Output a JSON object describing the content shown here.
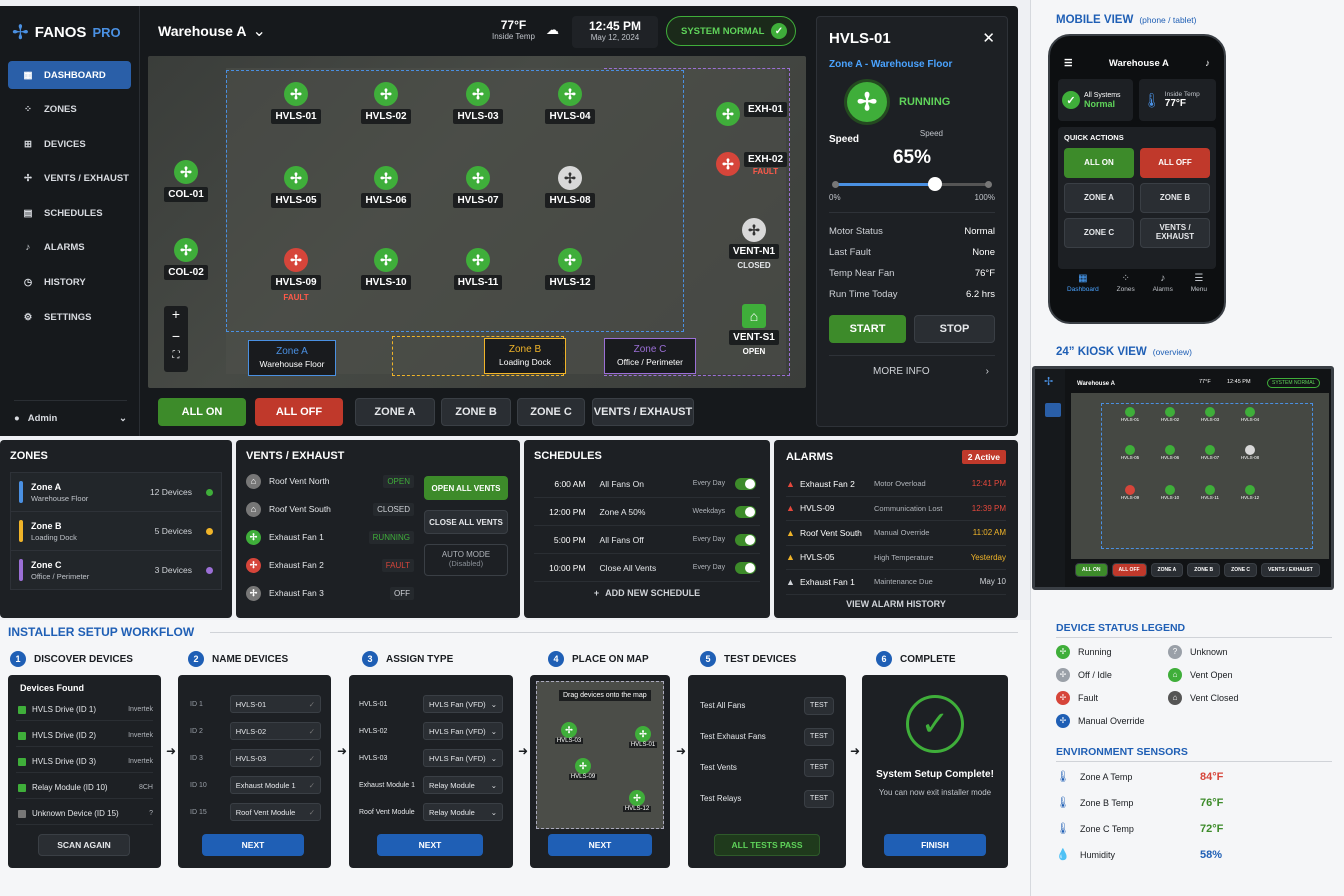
{
  "brand": {
    "name": "FANOS",
    "suffix": "PRO"
  },
  "sidebar": {
    "items": [
      {
        "label": "DASHBOARD",
        "icon": "dashboard-icon",
        "glyph": "▦"
      },
      {
        "label": "ZONES",
        "icon": "zones-icon",
        "glyph": "⁘"
      },
      {
        "label": "DEVICES",
        "icon": "devices-icon",
        "glyph": "⊞"
      },
      {
        "label": "VENTS / EXHAUST",
        "icon": "fan-icon",
        "glyph": "✢"
      },
      {
        "label": "SCHEDULES",
        "icon": "calendar-icon",
        "glyph": "▤"
      },
      {
        "label": "ALARMS",
        "icon": "bell-icon",
        "glyph": "♪"
      },
      {
        "label": "HISTORY",
        "icon": "clock-icon",
        "glyph": "◷"
      },
      {
        "label": "SETTINGS",
        "icon": "gear-icon",
        "glyph": "⚙"
      }
    ],
    "user": "Admin"
  },
  "header": {
    "location": "Warehouse A",
    "temp": "77°F",
    "temp_label": "Inside Temp",
    "time": "12:45 PM",
    "date": "May 12, 2024",
    "system_status": "SYSTEM NORMAL"
  },
  "map": {
    "fans": [
      {
        "id": "HVLS-01",
        "s": "g"
      },
      {
        "id": "HVLS-02",
        "s": "g"
      },
      {
        "id": "HVLS-03",
        "s": "g"
      },
      {
        "id": "HVLS-04",
        "s": "g"
      },
      {
        "id": "HVLS-05",
        "s": "g"
      },
      {
        "id": "HVLS-06",
        "s": "g"
      },
      {
        "id": "HVLS-07",
        "s": "g"
      },
      {
        "id": "HVLS-08",
        "s": "w"
      },
      {
        "id": "HVLS-09",
        "s": "r",
        "status": "FAULT"
      },
      {
        "id": "HVLS-10",
        "s": "g"
      },
      {
        "id": "HVLS-11",
        "s": "g"
      },
      {
        "id": "HVLS-12",
        "s": "g"
      }
    ],
    "col1": "COL-01",
    "col2": "COL-02",
    "exh1": "EXH-01",
    "exh2": "EXH-02",
    "exh2_status": "FAULT",
    "ventn": "VENT-N1",
    "ventn_status": "CLOSED",
    "vents": "VENT-S1",
    "vents_status": "OPEN",
    "zones": [
      {
        "name": "Zone A",
        "sub": "Warehouse Floor",
        "color": "#4a90e2"
      },
      {
        "name": "Zone B",
        "sub": "Loading Dock",
        "color": "#f0b429"
      },
      {
        "name": "Zone C",
        "sub": "Office / Perimeter",
        "color": "#9b6fd6"
      }
    ]
  },
  "actions": {
    "all_on": "ALL ON",
    "all_off": "ALL OFF",
    "zone_a": "ZONE A",
    "zone_b": "ZONE B",
    "zone_c": "ZONE C",
    "vents": "VENTS / EXHAUST"
  },
  "detail": {
    "title": "HVLS-01",
    "zone": "Zone A - Warehouse Floor",
    "state": "RUNNING",
    "speed_label": "Speed",
    "speed_small": "Speed",
    "speed": "65%",
    "speed_value": 65,
    "min": "0%",
    "max": "100%",
    "rows": [
      {
        "k": "Motor Status",
        "v": "Normal"
      },
      {
        "k": "Last Fault",
        "v": "None"
      },
      {
        "k": "Temp Near Fan",
        "v": "76°F"
      },
      {
        "k": "Run Time Today",
        "v": "6.2 hrs"
      }
    ],
    "start": "START",
    "stop": "STOP",
    "more": "MORE INFO"
  },
  "zones_panel": {
    "title": "ZONES",
    "items": [
      {
        "name": "Zone A",
        "sub": "Warehouse Floor",
        "count": "12 Devices",
        "color": "#4a90e2",
        "dot": "#3fae3a"
      },
      {
        "name": "Zone B",
        "sub": "Loading Dock",
        "count": "5 Devices",
        "color": "#f0b429",
        "dot": "#f0b429"
      },
      {
        "name": "Zone C",
        "sub": "Office / Perimeter",
        "count": "3 Devices",
        "color": "#9b6fd6",
        "dot": "#9b6fd6"
      }
    ]
  },
  "vents_panel": {
    "title": "VENTS / EXHAUST",
    "items": [
      {
        "name": "Roof Vent North",
        "status": "OPEN",
        "color": "#3fae3a",
        "icon": "vent-open-icon"
      },
      {
        "name": "Roof Vent South",
        "status": "CLOSED",
        "color": "#d0d3d8",
        "icon": "vent-closed-icon"
      },
      {
        "name": "Exhaust Fan 1",
        "status": "RUNNING",
        "color": "#3fae3a",
        "icon": "fan-running-icon"
      },
      {
        "name": "Exhaust Fan 2",
        "status": "FAULT",
        "color": "#d6453a",
        "icon": "fan-fault-icon"
      },
      {
        "name": "Exhaust Fan 3",
        "status": "OFF",
        "color": "#d0d3d8",
        "icon": "fan-off-icon"
      }
    ],
    "open_all": "OPEN ALL VENTS",
    "close_all": "CLOSE ALL VENTS",
    "auto": "AUTO MODE",
    "auto_sub": "(Disabled)"
  },
  "schedules": {
    "title": "SCHEDULES",
    "items": [
      {
        "time": "6:00 AM",
        "action": "All Fans On",
        "freq": "Every Day"
      },
      {
        "time": "12:00 PM",
        "action": "Zone A 50%",
        "freq": "Weekdays"
      },
      {
        "time": "5:00 PM",
        "action": "All Fans Off",
        "freq": "Every Day"
      },
      {
        "time": "10:00 PM",
        "action": "Close All Vents",
        "freq": "Every Day"
      }
    ],
    "add": "ADD NEW SCHEDULE"
  },
  "alarms": {
    "title": "ALARMS",
    "badge": "2 Active",
    "items": [
      {
        "name": "Exhaust Fan 2",
        "desc": "Motor Overload",
        "time": "12:41 PM",
        "color": "#e5483c"
      },
      {
        "name": "HVLS-09",
        "desc": "Communication Lost",
        "time": "12:39 PM",
        "color": "#e5483c"
      },
      {
        "name": "Roof Vent South",
        "desc": "Manual Override",
        "time": "11:02 AM",
        "color": "#f0b429"
      },
      {
        "name": "HVLS-05",
        "desc": "High Temperature",
        "time": "Yesterday",
        "color": "#f0b429"
      },
      {
        "name": "Exhaust Fan 1",
        "desc": "Maintenance Due",
        "time": "May 10",
        "color": "#d0d3d8"
      }
    ],
    "history": "VIEW ALARM HISTORY"
  },
  "installer": {
    "title": "INSTALLER SETUP WORKFLOW",
    "steps": [
      {
        "n": "1",
        "t": "DISCOVER DEVICES"
      },
      {
        "n": "2",
        "t": "NAME DEVICES"
      },
      {
        "n": "3",
        "t": "ASSIGN TYPE"
      },
      {
        "n": "4",
        "t": "PLACE ON MAP"
      },
      {
        "n": "5",
        "t": "TEST DEVICES"
      },
      {
        "n": "6",
        "t": "COMPLETE"
      }
    ],
    "found_title": "Devices Found",
    "found": [
      {
        "name": "HVLS Drive (ID 1)",
        "tag": "Invertek"
      },
      {
        "name": "HVLS Drive (ID 2)",
        "tag": "Invertek"
      },
      {
        "name": "HVLS Drive (ID 3)",
        "tag": "Invertek"
      },
      {
        "name": "Relay Module (ID 10)",
        "tag": "8CH"
      },
      {
        "name": "Unknown Device (ID 15)",
        "tag": "?"
      }
    ],
    "scan": "SCAN AGAIN",
    "names": [
      {
        "id": "ID 1",
        "v": "HVLS-01"
      },
      {
        "id": "ID 2",
        "v": "HVLS-02"
      },
      {
        "id": "ID 3",
        "v": "HVLS-03"
      },
      {
        "id": "ID 10",
        "v": "Exhaust Module 1"
      },
      {
        "id": "ID 15",
        "v": "Roof Vent Module"
      }
    ],
    "types": [
      {
        "n": "HVLS-01",
        "t": "HVLS Fan (VFD)"
      },
      {
        "n": "HVLS-02",
        "t": "HVLS Fan (VFD)"
      },
      {
        "n": "HVLS-03",
        "t": "HVLS Fan (VFD)"
      },
      {
        "n": "Exhaust Module 1",
        "t": "Relay Module"
      },
      {
        "n": "Roof Vent Module",
        "t": "Relay Module"
      }
    ],
    "map_hint": "Drag devices onto the map",
    "map_fans": [
      "HVLS-03",
      "HVLS-01",
      "HVLS-09",
      "HVLS-12"
    ],
    "tests": [
      "Test All Fans",
      "Test Exhaust Fans",
      "Test Vents",
      "Test Relays"
    ],
    "test_btn": "TEST",
    "pass": "ALL TESTS PASS",
    "complete_title": "System Setup Complete!",
    "complete_sub": "You can now exit installer mode",
    "next": "NEXT",
    "finish": "FINISH"
  },
  "mobile": {
    "title": "MOBILE VIEW",
    "sub": "(phone / tablet)",
    "header": "Warehouse A",
    "all_systems": "All Systems",
    "normal": "Normal",
    "inside": "Inside Temp",
    "temp": "77°F",
    "quick": "QUICK ACTIONS",
    "btns": [
      "ALL ON",
      "ALL OFF",
      "ZONE A",
      "ZONE B",
      "ZONE C",
      "VENTS / EXHAUST"
    ],
    "tabs": [
      "Dashboard",
      "Zones",
      "Alarms",
      "Menu"
    ]
  },
  "kiosk": {
    "title": "24” KIOSK VIEW",
    "sub": "(overview)",
    "header": "Warehouse A",
    "temp": "77°F",
    "time": "12:45 PM",
    "status": "SYSTEM NORMAL",
    "btns": [
      "ALL ON",
      "ALL OFF",
      "ZONE A",
      "ZONE B",
      "ZONE C",
      "VENTS / EXHAUST"
    ]
  },
  "legend": {
    "title": "DEVICE STATUS LEGEND",
    "items": [
      {
        "t": "Running",
        "c": "#3fae3a"
      },
      {
        "t": "Unknown",
        "c": "#9aa0a8"
      },
      {
        "t": "Off / Idle",
        "c": "#9aa0a8"
      },
      {
        "t": "Vent Open",
        "c": "#3fae3a"
      },
      {
        "t": "Fault",
        "c": "#d6453a"
      },
      {
        "t": "Vent Closed",
        "c": "#555"
      },
      {
        "t": "Manual Override",
        "c": "#1f5fb5"
      }
    ]
  },
  "env": {
    "title": "ENVIRONMENT SENSORS",
    "items": [
      {
        "name": "Zone A Temp",
        "v": "84°F",
        "c": "#d6453a"
      },
      {
        "name": "Zone B Temp",
        "v": "76°F",
        "c": "#3d8b2a"
      },
      {
        "name": "Zone C Temp",
        "v": "72°F",
        "c": "#3d8b2a"
      },
      {
        "name": "Humidity",
        "v": "58%",
        "c": "#1f5fb5"
      }
    ]
  }
}
